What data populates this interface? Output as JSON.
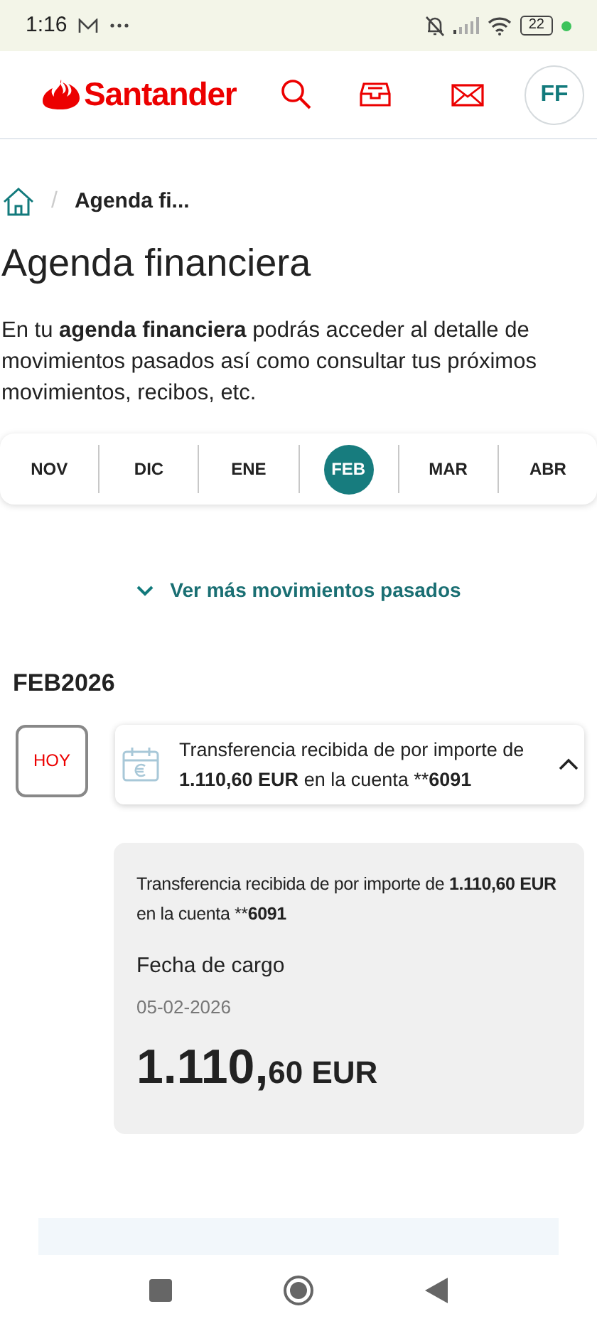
{
  "status_bar": {
    "time": "1:16",
    "battery": "22"
  },
  "header": {
    "brand": "Santander",
    "avatar": "FF"
  },
  "breadcrumb": {
    "separator": "/",
    "current": "Agenda fi..."
  },
  "title": "Agenda financiera",
  "description": "En tu **agenda financiera** podrás acceder al detalle de movimientos pasados así como consultar tus próximos movimientos, recibos, etc.",
  "months": [
    {
      "label": "NOV",
      "selected": false
    },
    {
      "label": "DIC",
      "selected": false
    },
    {
      "label": "ENE",
      "selected": false
    },
    {
      "label": "FEB",
      "selected": true
    },
    {
      "label": "MAR",
      "selected": false
    },
    {
      "label": "ABR",
      "selected": false
    }
  ],
  "more_link": "Ver más movimientos pasados",
  "period": "FEB2026",
  "movement": {
    "day_badge": "HOY",
    "expanded": true,
    "text": [
      {
        "text": "Transferencia recibida de por importe de ",
        "bold": false
      },
      {
        "text": "1.110,60 EUR",
        "bold": true
      },
      {
        "text": " en la cuenta **",
        "bold": false
      },
      {
        "text": "6091",
        "bold": true
      }
    ],
    "detail": {
      "text": [
        {
          "text": "Transferencia recibida de por importe de ",
          "bold": false
        },
        {
          "text": "1.110,60 EUR",
          "bold": true
        },
        {
          "text": " en la cuenta **",
          "bold": false
        },
        {
          "text": "6091",
          "bold": true
        }
      ],
      "date_label": "Fecha de cargo",
      "date": "05-02-2026",
      "amount_main": "1.110,",
      "amount_minor": "60 EUR"
    }
  }
}
